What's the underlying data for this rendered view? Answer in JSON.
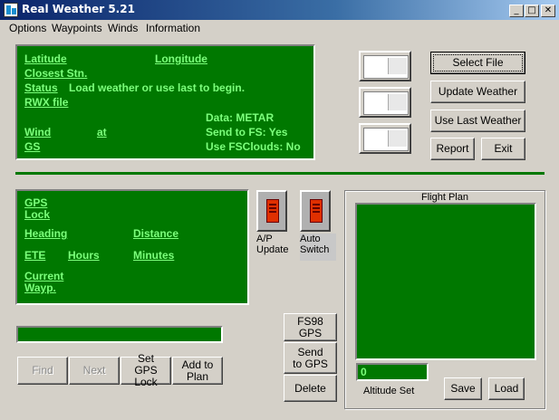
{
  "window": {
    "title": "Real Weather 5.21"
  },
  "menu": [
    "Options",
    "Waypoints",
    "Winds",
    "Information"
  ],
  "weather_panel": {
    "latitude": "Latitude",
    "longitude": "Longitude",
    "closest_stn": "Closest Stn.",
    "status_label": "Status",
    "status_value": "Load weather or use last to begin.",
    "rwx_file": "RWX file",
    "data": "Data: METAR",
    "send_to_fs": "Send to FS: Yes",
    "use_fsclouds": "Use FSClouds: No",
    "wind": "Wind",
    "at": "at",
    "gs": "GS"
  },
  "buttons": {
    "select_file": "Select File",
    "update_weather": "Update Weather",
    "use_last_weather": "Use Last Weather",
    "report": "Report",
    "exit": "Exit",
    "find": "Find",
    "next": "Next",
    "set_gps_lock": "Set GPS Lock",
    "add_to_plan": "Add to Plan",
    "fs98_gps": "FS98 GPS",
    "send_to_gps": "Send to GPS",
    "delete": "Delete",
    "save": "Save",
    "load": "Load"
  },
  "gps_panel": {
    "gps_lock": "GPS Lock",
    "heading": "Heading",
    "distance": "Distance",
    "ete": "ETE",
    "hours": "Hours",
    "minutes": "Minutes",
    "current_wayp": "Current Wayp."
  },
  "switches": {
    "ap_update": "A/P Update",
    "auto_switch": "Auto Switch"
  },
  "flight_plan": {
    "title": "Flight Plan",
    "altitude_value": "0",
    "altitude_label": "Altitude Set"
  },
  "colors": {
    "panel_green": "#007800",
    "text_green": "#7cff7c",
    "face": "#d4d0c8"
  }
}
